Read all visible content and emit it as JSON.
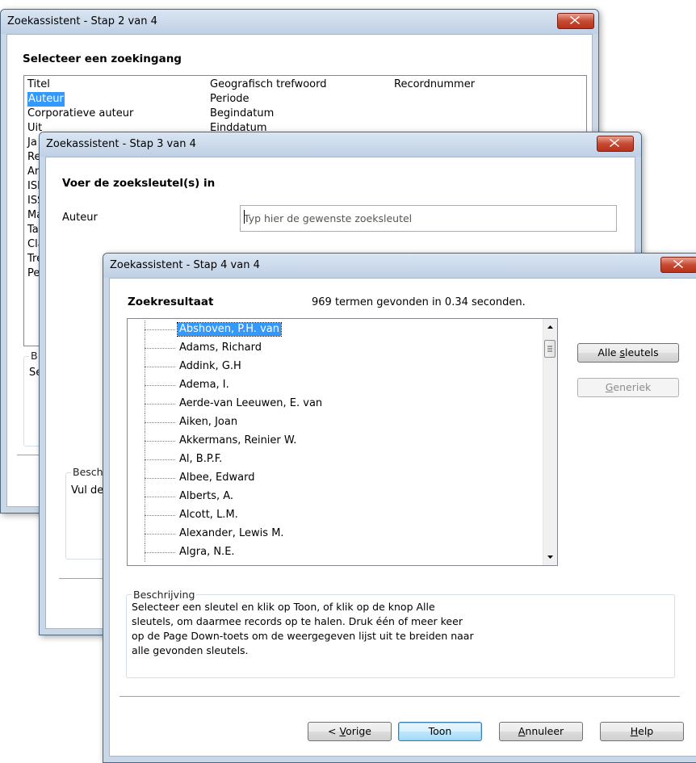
{
  "step2": {
    "title": "Zoekassistent - Stap 2 van 4",
    "heading": "Selecteer een zoekingang",
    "col1": [
      "Titel",
      "Auteur",
      "Corporatieve auteur",
      "Uit",
      "Ja",
      "Re",
      "An",
      "ISI",
      "ISS",
      "Ma",
      "Ta",
      "Cla",
      "Tre",
      "Pe"
    ],
    "col2": [
      "Geografisch trefwoord",
      "Periode",
      "Begindatum",
      "Einddatum"
    ],
    "col3": [
      "Recordnummer"
    ],
    "selected": "Auteur",
    "group_legend_partial": "B",
    "group_text_partial": "Se"
  },
  "step3": {
    "title": "Zoekassistent - Stap 3 van 4",
    "heading": "Voer de zoeksleutel(s) in",
    "field_label": "Auteur",
    "field_placeholder": "Typ hier de gewenste zoeksleutel",
    "group_legend_partial": "Besch",
    "group_text_partial": "Vul de"
  },
  "step4": {
    "title": "Zoekassistent - Stap 4 van 4",
    "heading": "Zoekresultaat",
    "result_info": "969 termen gevonden in 0.34 seconden.",
    "results": [
      "Abshoven, P.H. van",
      "Adams, Richard",
      "Addink, G.H",
      "Adema, I.",
      "Aerde-van Leeuwen, E. van",
      "Aiken, Joan",
      "Akkermans, Reinier W.",
      "Al, B.P.F.",
      "Albee, Edward",
      "Alberts, A.",
      "Alcott, L.M.",
      "Alexander, Lewis M.",
      "Algra, N.E."
    ],
    "selected_index": 0,
    "btn_alle": {
      "pre": "Alle ",
      "u": "s",
      "post": "leutels"
    },
    "btn_generiek": {
      "pre": "",
      "u": "G",
      "post": "eneriek"
    },
    "desc_legend": "Beschrijving",
    "desc_lines": [
      "Selecteer een sleutel en klik op Toon, of klik op de knop Alle",
      "sleutels, om daarmee records op te halen. Druk één of meer keer",
      "op de Page Down-toets om de weergegeven lijst uit te breiden naar",
      "alle gevonden sleutels."
    ],
    "btn_vorige": {
      "pre": "< ",
      "u": "V",
      "post": "orige"
    },
    "btn_toon": "Toon",
    "btn_annuleer": {
      "pre": "",
      "u": "A",
      "post": "nnuleer"
    },
    "btn_help": {
      "pre": "",
      "u": "H",
      "post": "elp"
    }
  },
  "colors": {
    "selection": "#3399ff",
    "close_button": "#c74a33",
    "titlebar": "#c9d7e6"
  },
  "icons": [
    "close-icon",
    "scroll-up-arrow-icon",
    "scroll-down-arrow-icon",
    "scroll-grip-icon"
  ]
}
